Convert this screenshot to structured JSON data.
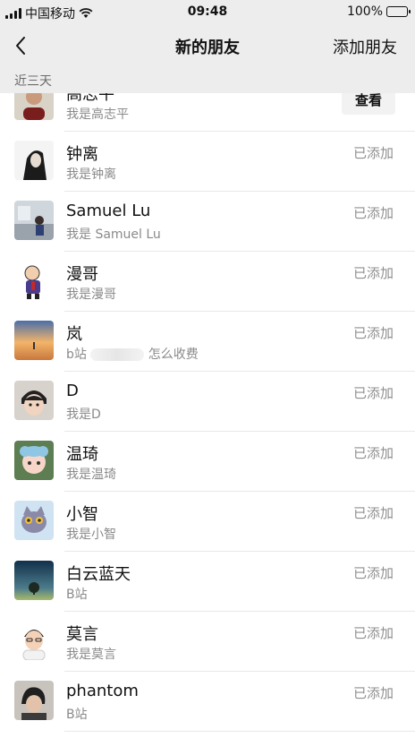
{
  "status_bar": {
    "carrier": "中国移动",
    "time": "09:48",
    "battery": "100%"
  },
  "nav": {
    "title": "新的朋友",
    "action": "添加朋友"
  },
  "section_label": "近三天",
  "contacts": [
    {
      "name": "高志平",
      "message": "我是高志平",
      "button": "查看",
      "avatar_icon": "person-photo-icon"
    },
    {
      "name": "钟离",
      "message": "我是钟离",
      "status": "已添加",
      "avatar_icon": "anime-character-icon"
    },
    {
      "name": "Samuel Lu",
      "message": "我是 Samuel Lu",
      "status": "已添加",
      "avatar_icon": "room-photo-icon"
    },
    {
      "name": "漫哥",
      "message": "我是漫哥",
      "status": "已添加",
      "avatar_icon": "cartoon-man-icon"
    },
    {
      "name": "岚",
      "message_prefix": "b站",
      "message_suffix": "怎么收费",
      "status": "已添加",
      "avatar_icon": "sunset-photo-icon"
    },
    {
      "name": "D",
      "message": "我是D",
      "status": "已添加",
      "avatar_icon": "anime-face-icon"
    },
    {
      "name": "温琦",
      "message": "我是温琦",
      "status": "已添加",
      "avatar_icon": "plush-toy-icon"
    },
    {
      "name": "小智",
      "message": "我是小智",
      "status": "已添加",
      "avatar_icon": "cartoon-cat-icon"
    },
    {
      "name": "白云蓝天",
      "message": "B站",
      "status": "已添加",
      "avatar_icon": "night-tree-icon"
    },
    {
      "name": "莫言",
      "message": "我是莫言",
      "status": "已添加",
      "avatar_icon": "cartoon-boy-icon"
    },
    {
      "name": "phantom",
      "message": "B站",
      "status": "已添加",
      "avatar_icon": "person-photo-icon"
    }
  ]
}
